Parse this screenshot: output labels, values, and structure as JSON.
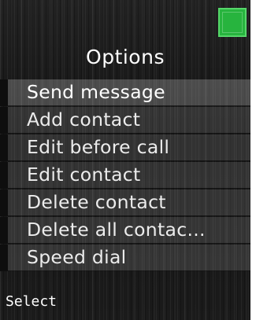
{
  "status": {
    "battery_icon": "battery-full-icon",
    "battery_color": "#27b43e"
  },
  "title": "Options",
  "menu": {
    "items": [
      {
        "label": "Send message",
        "selected": true
      },
      {
        "label": "Add contact"
      },
      {
        "label": "Edit before call"
      },
      {
        "label": "Edit contact"
      },
      {
        "label": "Delete contact"
      },
      {
        "label": "Delete all contac..."
      },
      {
        "label": "Speed dial"
      }
    ]
  },
  "softkeys": {
    "left": "Select"
  }
}
